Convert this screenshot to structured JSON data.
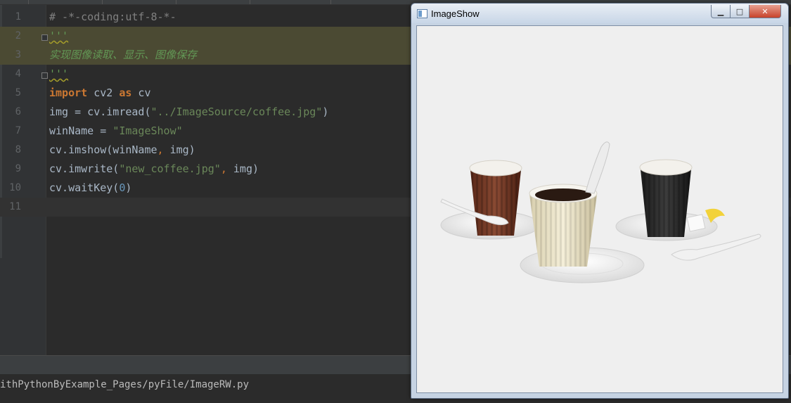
{
  "editor": {
    "lines": [
      {
        "n": "1",
        "parts": [
          {
            "t": "# -*-coding:utf-8-*-",
            "c": "c-comment"
          }
        ]
      },
      {
        "n": "2",
        "parts": [
          {
            "t": "'''",
            "c": "c-doc-wavy"
          }
        ],
        "hl": true
      },
      {
        "n": "3",
        "parts": [
          {
            "t": "实现图像读取、显示、图像保存",
            "c": "c-doc"
          }
        ],
        "hl": true
      },
      {
        "n": "4",
        "parts": [
          {
            "t": "'''",
            "c": "c-doc-wavy"
          }
        ]
      },
      {
        "n": "5",
        "parts": [
          {
            "t": "import",
            "c": "c-kw"
          },
          {
            "t": " cv2 ",
            "c": ""
          },
          {
            "t": "as",
            "c": "c-kw"
          },
          {
            "t": " cv",
            "c": ""
          }
        ]
      },
      {
        "n": "6",
        "parts": [
          {
            "t": "img = cv.imread(",
            "c": ""
          },
          {
            "t": "\"../ImageSource/coffee.jpg\"",
            "c": "c-str"
          },
          {
            "t": ")",
            "c": ""
          }
        ]
      },
      {
        "n": "7",
        "parts": [
          {
            "t": "winName = ",
            "c": ""
          },
          {
            "t": "\"ImageShow\"",
            "c": "c-str"
          }
        ]
      },
      {
        "n": "8",
        "parts": [
          {
            "t": "cv.imshow(winName",
            "c": ""
          },
          {
            "t": ",",
            "c": "c-comma"
          },
          {
            "t": " img)",
            "c": ""
          }
        ]
      },
      {
        "n": "9",
        "parts": [
          {
            "t": "cv.imwrite(",
            "c": ""
          },
          {
            "t": "\"new_coffee.jpg\"",
            "c": "c-str"
          },
          {
            "t": ",",
            "c": "c-comma"
          },
          {
            "t": " img)",
            "c": ""
          }
        ]
      },
      {
        "n": "10",
        "parts": [
          {
            "t": "cv.waitKey(",
            "c": ""
          },
          {
            "t": "0",
            "c": "c-num"
          },
          {
            "t": ")",
            "c": ""
          }
        ]
      },
      {
        "n": "11",
        "parts": [],
        "cur": true
      }
    ]
  },
  "status": {
    "path": "ithPythonByExample_Pages/pyFile/ImageRW.py"
  },
  "window": {
    "title": "ImageShow",
    "minimize_glyph": "▁",
    "maximize_glyph": "□",
    "close_glyph": "✕"
  },
  "colors": {
    "editor_bg": "#2b2b2b",
    "keyword": "#cc7832",
    "string": "#6a8759",
    "docstring": "#629755",
    "number": "#6897bb",
    "highlight": "#4b4a33"
  }
}
